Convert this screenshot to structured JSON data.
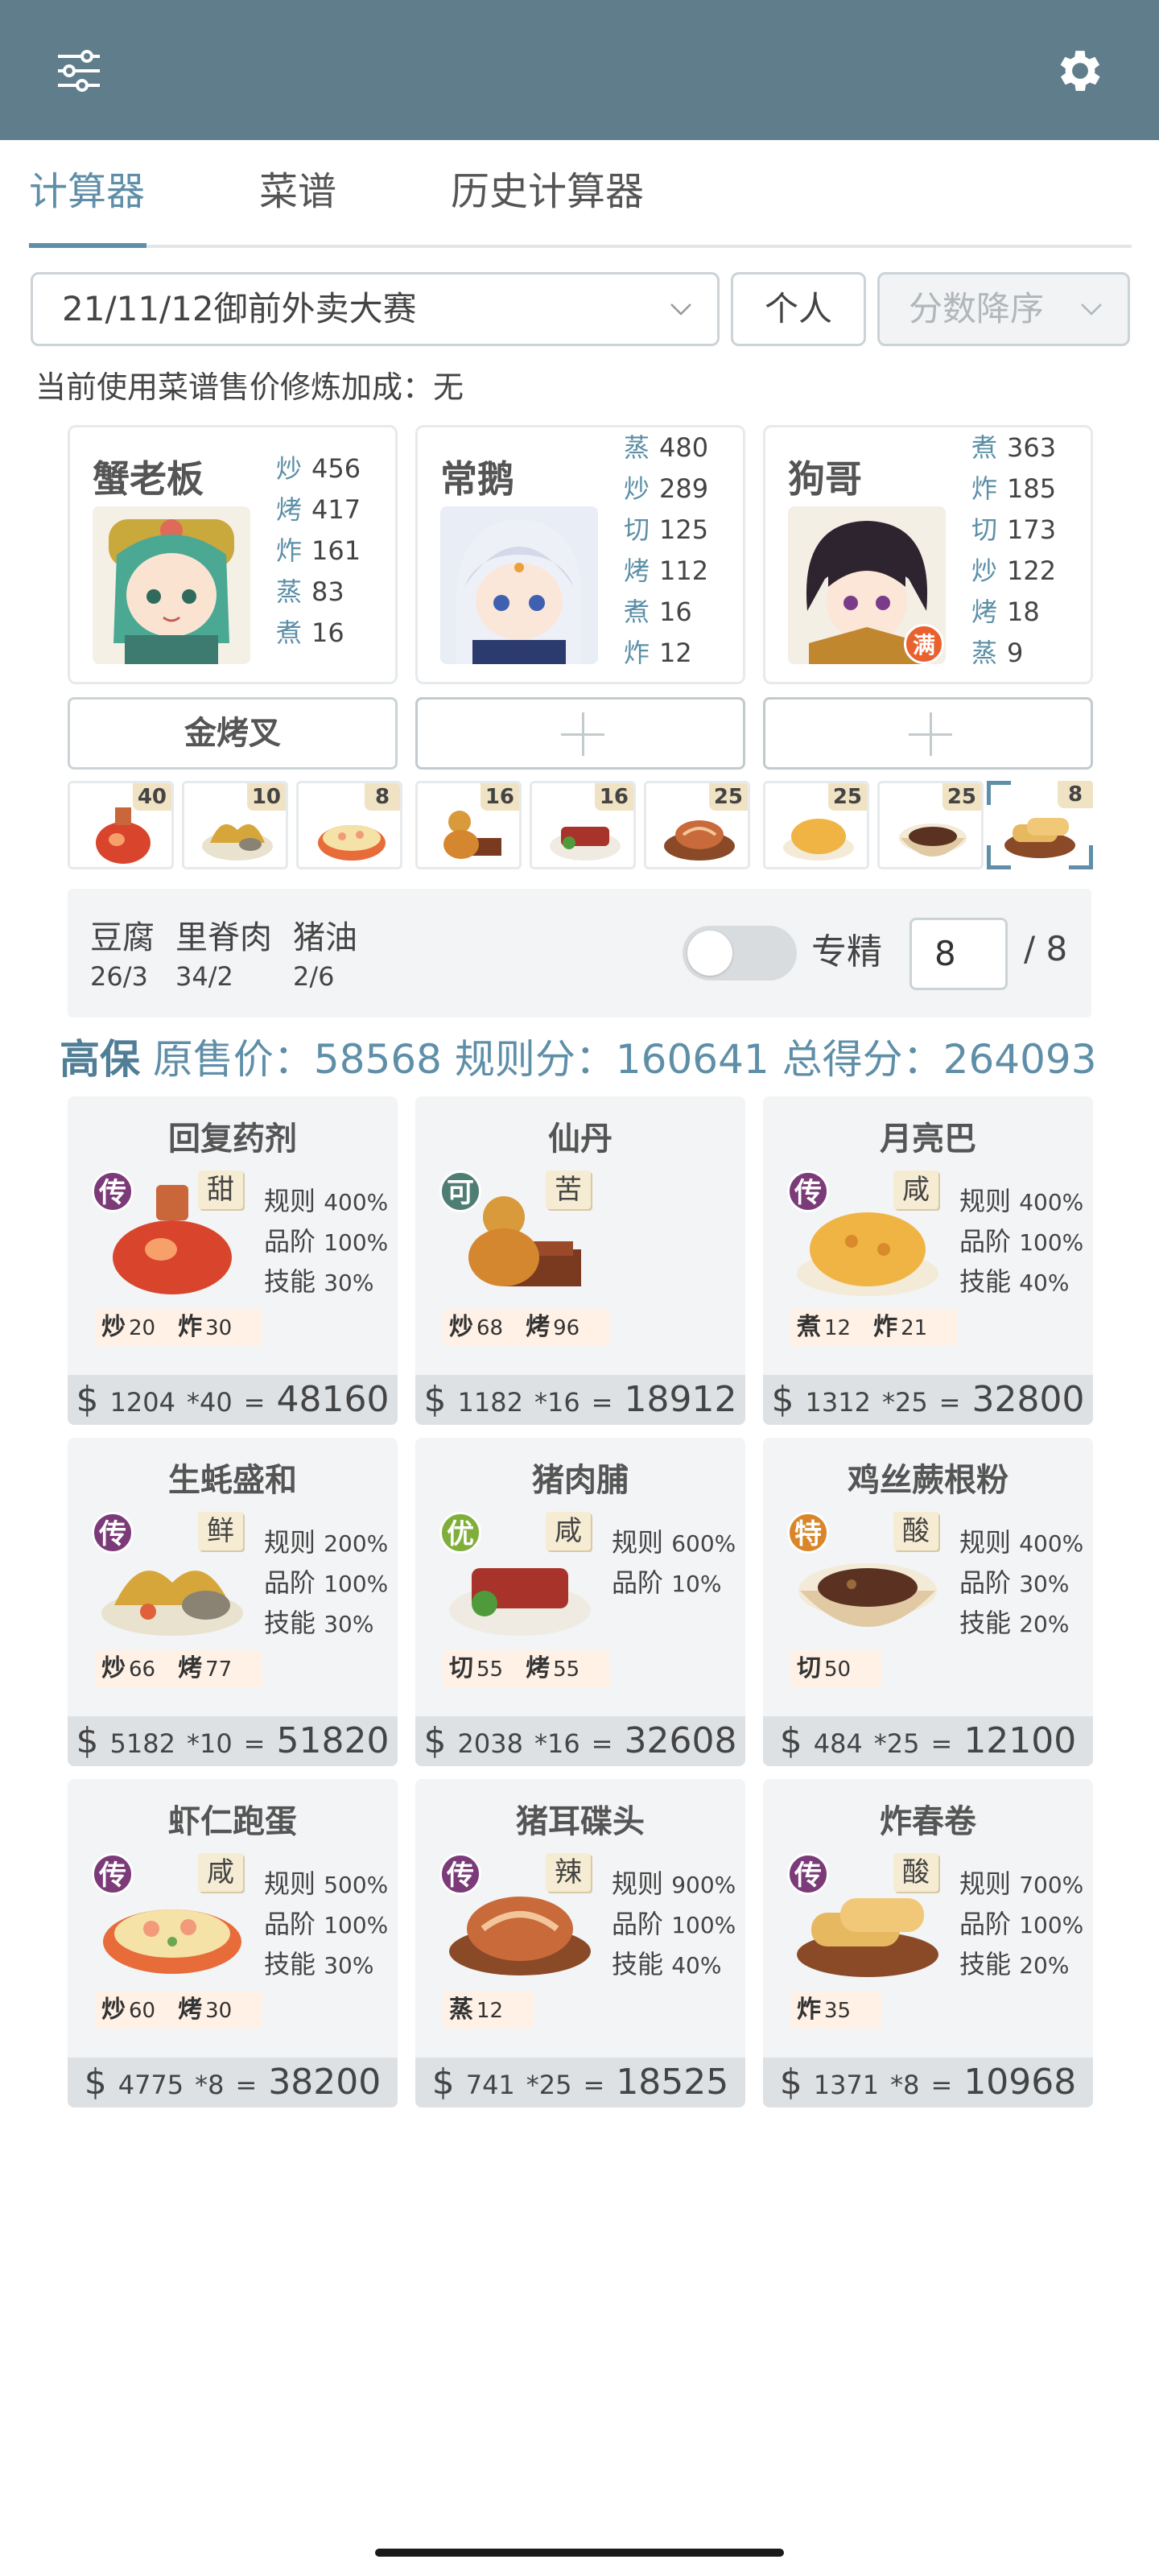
{
  "header": {
    "filter_icon": "sliders-icon",
    "settings_icon": "gear-icon"
  },
  "tabs": [
    {
      "label": "计算器",
      "active": true
    },
    {
      "label": "菜谱",
      "active": false
    },
    {
      "label": "历史计算器",
      "active": false
    }
  ],
  "controls": {
    "contest": "21/11/12御前外卖大赛",
    "mode": "个人",
    "sort": "分数降序"
  },
  "bonus_text": "当前使用菜谱售价修炼加成：无",
  "chefs": [
    {
      "name": "蟹老板",
      "skills": [
        {
          "k": "炒",
          "v": "456"
        },
        {
          "k": "烤",
          "v": "417"
        },
        {
          "k": "炸",
          "v": "161"
        },
        {
          "k": "蒸",
          "v": "83"
        },
        {
          "k": "煮",
          "v": "16"
        }
      ],
      "tool": "金烤叉"
    },
    {
      "name": "常鹅",
      "skills": [
        {
          "k": "蒸",
          "v": "480"
        },
        {
          "k": "炒",
          "v": "289"
        },
        {
          "k": "切",
          "v": "125"
        },
        {
          "k": "烤",
          "v": "112"
        },
        {
          "k": "煮",
          "v": "16"
        },
        {
          "k": "炸",
          "v": "12"
        }
      ],
      "tool": ""
    },
    {
      "name": "狗哥",
      "skills": [
        {
          "k": "煮",
          "v": "363"
        },
        {
          "k": "炸",
          "v": "185"
        },
        {
          "k": "切",
          "v": "173"
        },
        {
          "k": "炒",
          "v": "122"
        },
        {
          "k": "烤",
          "v": "18"
        },
        {
          "k": "蒸",
          "v": "9"
        }
      ],
      "tool": "",
      "badge": "满"
    }
  ],
  "thumb_counts": [
    "40",
    "10",
    "8",
    "16",
    "16",
    "25",
    "25",
    "25",
    "8"
  ],
  "ingredients": [
    {
      "name": "豆腐",
      "qty": "26/3"
    },
    {
      "name": "里脊肉",
      "qty": "34/2"
    },
    {
      "name": "猪油",
      "qty": "2/6"
    }
  ],
  "specialty": {
    "label": "专精",
    "value": "8",
    "max": "/ 8",
    "enabled": false
  },
  "score": {
    "grade": "高保",
    "price_label": "原售价：",
    "price": "58568",
    "rule_label": "规则分：",
    "rule": "160641",
    "total_label": "总得分：",
    "total": "264093"
  },
  "recipes": [
    {
      "name": "回复药剂",
      "rarity": "传",
      "taste": "甜",
      "rule": "400%",
      "grade": "100%",
      "skill": "30%",
      "skills": [
        {
          "k": "炒",
          "v": "20"
        },
        {
          "k": "炸",
          "v": "30"
        }
      ],
      "price": "1204",
      "mult": "*40",
      "total": "48160"
    },
    {
      "name": "仙丹",
      "rarity": "可",
      "taste": "苦",
      "rule": "",
      "grade": "",
      "skill": "",
      "skills": [
        {
          "k": "炒",
          "v": "68"
        },
        {
          "k": "烤",
          "v": "96"
        }
      ],
      "price": "1182",
      "mult": "*16",
      "total": "18912"
    },
    {
      "name": "月亮巴",
      "rarity": "传",
      "taste": "咸",
      "rule": "400%",
      "grade": "100%",
      "skill": "40%",
      "skills": [
        {
          "k": "煮",
          "v": "12"
        },
        {
          "k": "炸",
          "v": "21"
        }
      ],
      "price": "1312",
      "mult": "*25",
      "total": "32800"
    },
    {
      "name": "生蚝盛和",
      "rarity": "传",
      "taste": "鲜",
      "rule": "200%",
      "grade": "100%",
      "skill": "30%",
      "skills": [
        {
          "k": "炒",
          "v": "66"
        },
        {
          "k": "烤",
          "v": "77"
        }
      ],
      "price": "5182",
      "mult": "*10",
      "total": "51820"
    },
    {
      "name": "猪肉脯",
      "rarity": "优",
      "taste": "咸",
      "rule": "600%",
      "grade": "10%",
      "skill": "",
      "skills": [
        {
          "k": "切",
          "v": "55"
        },
        {
          "k": "烤",
          "v": "55"
        }
      ],
      "price": "2038",
      "mult": "*16",
      "total": "32608"
    },
    {
      "name": "鸡丝蕨根粉",
      "rarity": "特",
      "taste": "酸",
      "rule": "400%",
      "grade": "30%",
      "skill": "20%",
      "skills": [
        {
          "k": "切",
          "v": "50"
        }
      ],
      "price": "484",
      "mult": "*25",
      "total": "12100"
    },
    {
      "name": "虾仁跑蛋",
      "rarity": "传",
      "taste": "咸",
      "rule": "500%",
      "grade": "100%",
      "skill": "30%",
      "skills": [
        {
          "k": "炒",
          "v": "60"
        },
        {
          "k": "烤",
          "v": "30"
        }
      ],
      "price": "4775",
      "mult": "*8",
      "total": "38200"
    },
    {
      "name": "猪耳碟头",
      "rarity": "传",
      "taste": "辣",
      "rule": "900%",
      "grade": "100%",
      "skill": "40%",
      "skills": [
        {
          "k": "蒸",
          "v": "12"
        }
      ],
      "price": "741",
      "mult": "*25",
      "total": "18525"
    },
    {
      "name": "炸春卷",
      "rarity": "传",
      "taste": "酸",
      "rule": "700%",
      "grade": "100%",
      "skill": "20%",
      "skills": [
        {
          "k": "炸",
          "v": "35"
        }
      ],
      "price": "1371",
      "mult": "*8",
      "total": "10968"
    }
  ],
  "labels": {
    "rule": "规则",
    "grade": "品阶",
    "skill": "技能",
    "currency": "$",
    "equals": "="
  },
  "colors": {
    "header": "#607d8b",
    "accent": "#5f8fa8",
    "legend": "#7b3a78",
    "rare": "#4e7d73",
    "good": "#7fae3a",
    "special": "#d9862b"
  }
}
